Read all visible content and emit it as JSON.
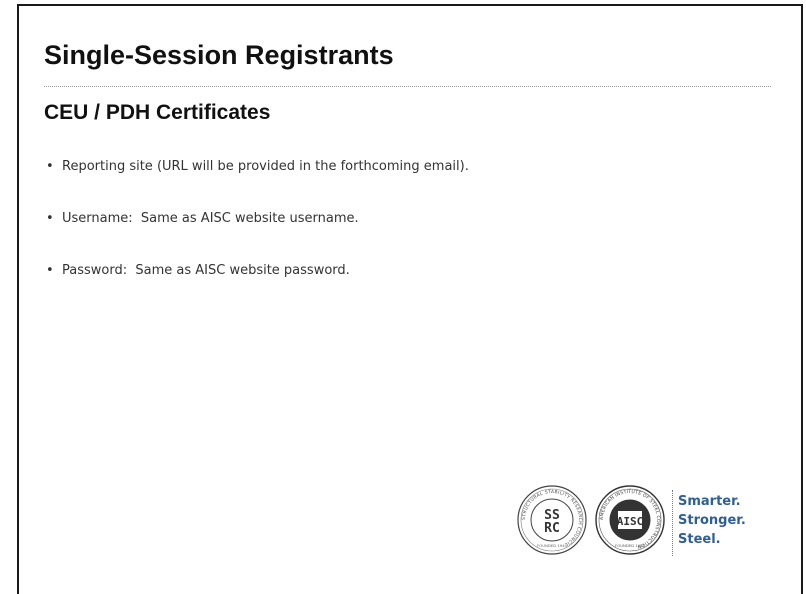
{
  "slide": {
    "title": "Single-Session Registrants",
    "subtitle": "CEU / PDH Certificates",
    "bullets": [
      {
        "text": "Reporting site (URL will be provided in the forthcoming email)."
      },
      {
        "text": "Username:  Same as AISC website username."
      },
      {
        "text": "Password:  Same as AISC website password."
      }
    ],
    "bullet_glyph": "•"
  },
  "logos": {
    "ssrc_seal": {
      "ring_text": "STRUCTURAL STABILITY RESEARCH COUNCIL",
      "center": "SSRC",
      "founded": "FOUNDED 1944"
    },
    "aisc_seal": {
      "ring_text": "AMERICAN INSTITUTE OF STEEL CONSTRUCTION",
      "center": "AISC",
      "founded": "FOUNDED 1921"
    },
    "tagline": [
      "Smarter.",
      "Stronger.",
      "Steel."
    ]
  },
  "colors": {
    "title": "#111111",
    "body_text": "#333333",
    "tagline": "#2e5f96",
    "border": "#1a1a1a"
  }
}
